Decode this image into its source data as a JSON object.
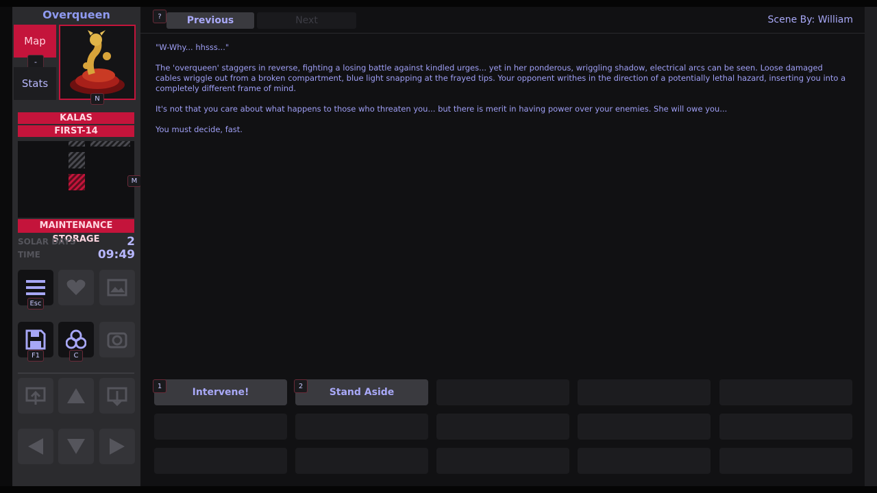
{
  "sidebar": {
    "character_name": "Overqueen",
    "map_label": "Map",
    "stats_label": "Stats",
    "map_stats_key": "-",
    "portrait_key": "N",
    "minimap_key": "M",
    "region": "KALAS",
    "floor": "FIRST-14",
    "room": "MAINTENANCE STORAGE",
    "solar_days_label": "SOLAR DAYS",
    "solar_days_value": "2",
    "time_label": "TIME",
    "time_value": "09:49",
    "buttons": {
      "menu_key": "Esc",
      "save_key": "F1",
      "character_key": "C"
    }
  },
  "main": {
    "help_key": "?",
    "previous_label": "Previous",
    "next_label": "Next",
    "scene_by": "Scene By: William",
    "paragraphs": [
      "\"W-Why... hhsss...\"",
      "The 'overqueen' staggers in reverse, fighting a losing battle against kindled urges... yet in her ponderous, wriggling shadow, electrical arcs can be seen. Loose damaged cables wriggle out from a broken compartment, blue light snapping at the frayed tips. Your opponent writhes in the direction of a potentially lethal hazard, inserting you into a completely different frame of mind.",
      "It's not that you care about what happens to those who threaten you... but there is merit in having power over your enemies. She will owe you...",
      "You must decide, fast."
    ],
    "choices": [
      {
        "key": "1",
        "label": "Intervene!"
      },
      {
        "key": "2",
        "label": "Stand Aside"
      }
    ]
  },
  "colors": {
    "accent": "#c4143b",
    "text": "#a9a9f8"
  }
}
